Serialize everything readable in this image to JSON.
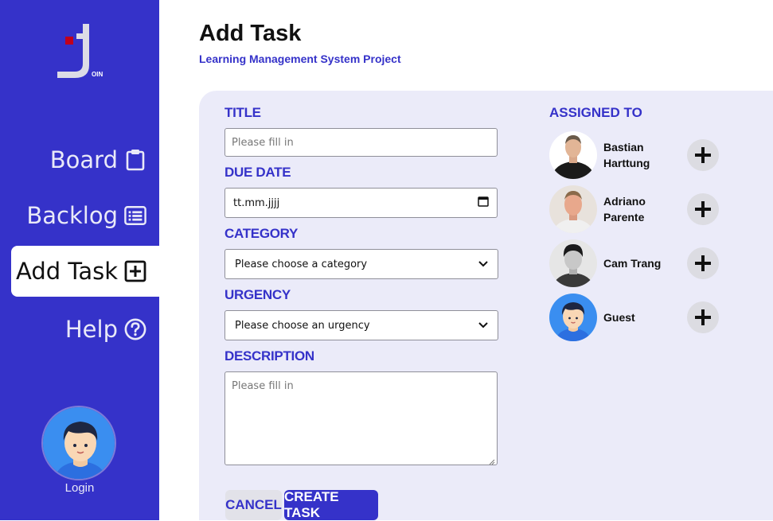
{
  "sidebar": {
    "logo_text": "OIN",
    "nav": [
      {
        "label": "Board",
        "icon": "clipboard-icon"
      },
      {
        "label": "Backlog",
        "icon": "list-icon"
      },
      {
        "label": "Add Task",
        "icon": "plus-square-icon"
      },
      {
        "label": "Help",
        "icon": "help-circle-icon"
      }
    ],
    "login_label": "Login"
  },
  "header": {
    "title": "Add Task",
    "subtitle": "Learning Management System Project"
  },
  "form": {
    "title_label": "TITLE",
    "title_placeholder": "Please fill in",
    "due_date_label": "DUE DATE",
    "due_date_value": "tt.mm.jjjj",
    "category_label": "CATEGORY",
    "category_value": "Please choose a category",
    "urgency_label": "URGENCY",
    "urgency_value": "Please choose an urgency",
    "description_label": "DESCRIPTION",
    "description_placeholder": "Please fill in",
    "cancel_label": "CANCEL",
    "create_label": "CREATE TASK"
  },
  "assigned": {
    "label": "ASSIGNED TO",
    "users": [
      {
        "name": "Bastian Harttung"
      },
      {
        "name": "Adriano Parente"
      },
      {
        "name": "Cam Trang"
      },
      {
        "name": "Guest"
      }
    ]
  },
  "colors": {
    "primary": "#3532c9",
    "panel_bg": "#ebebf9",
    "avatar_blue": "#3a8ef0"
  }
}
